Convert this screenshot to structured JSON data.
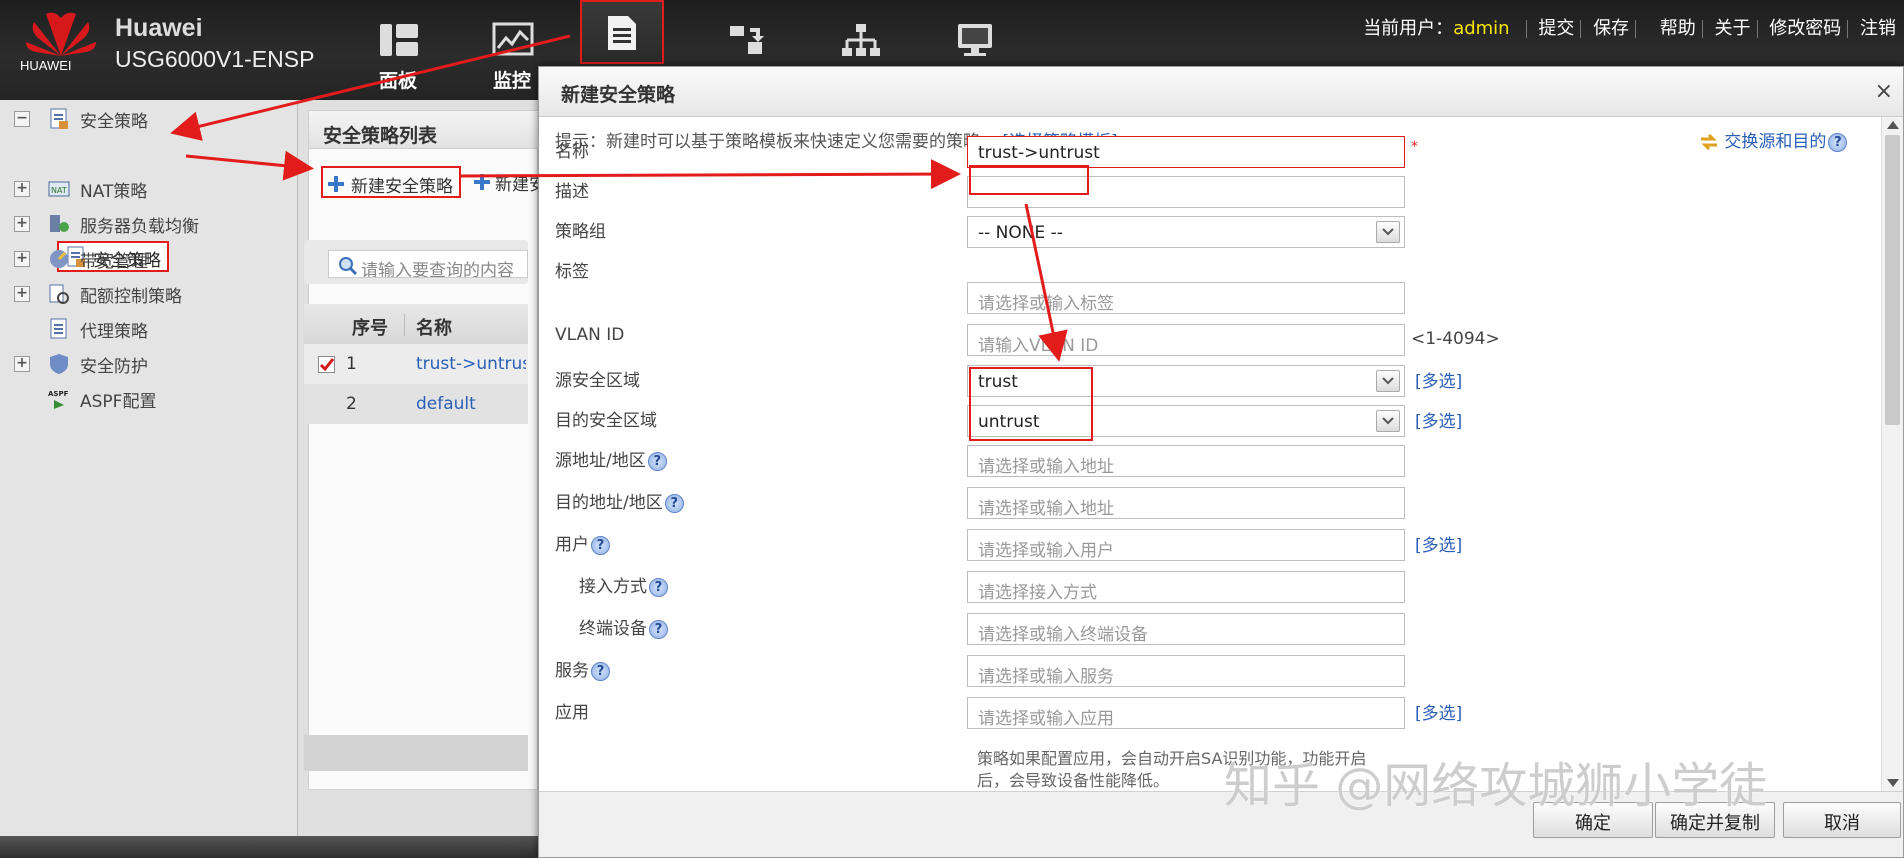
{
  "header": {
    "brand": "Huawei",
    "logo_text": "HUAWEI",
    "model": "USG6000V1-ENSP",
    "nav": [
      {
        "label": "面板",
        "icon": "dashboard-icon"
      },
      {
        "label": "监控",
        "icon": "monitor-chart-icon"
      },
      {
        "label": "",
        "icon": "policy-document-icon"
      },
      {
        "label": "",
        "icon": "object-icon"
      },
      {
        "label": "",
        "icon": "network-topology-icon"
      },
      {
        "label": "",
        "icon": "system-computer-icon"
      }
    ],
    "current_user_label": "当前用户：",
    "user": "admin",
    "links": [
      "提交",
      "保存",
      "帮助",
      "关于",
      "修改密码",
      "注销"
    ]
  },
  "sidebar": {
    "items": [
      {
        "label": "安全策略",
        "expander": "−",
        "icon": "security-policy-icon"
      },
      {
        "label": "安全策略",
        "icon": "security-policy-sub-icon"
      },
      {
        "label": "NAT策略",
        "expander": "+",
        "icon": "nat-icon"
      },
      {
        "label": "服务器负载均衡",
        "expander": "+",
        "icon": "server-lb-icon"
      },
      {
        "label": "带宽管理",
        "expander": "+",
        "icon": "bandwidth-icon"
      },
      {
        "label": "配额控制策略",
        "expander": "+",
        "icon": "quota-icon"
      },
      {
        "label": "代理策略",
        "icon": "proxy-icon"
      },
      {
        "label": "安全防护",
        "expander": "+",
        "icon": "shield-icon"
      },
      {
        "label": "ASPF配置",
        "icon": "aspf-icon"
      }
    ]
  },
  "list_panel": {
    "title": "安全策略列表",
    "new_button": "新建安全策略",
    "new_button2": "新建安",
    "search_placeholder": "请输入要查询的内容",
    "columns": [
      "序号",
      "名称"
    ],
    "rows": [
      {
        "no": "1",
        "name": "trust->untrust",
        "checked": true
      },
      {
        "no": "2",
        "name": "default",
        "checked": false
      }
    ]
  },
  "dialog": {
    "title": "新建安全策略",
    "close": "×",
    "hint": "提示：新建时可以基于策略模板来快速定义您需要的策略。",
    "hint_link": "[选择策略模板]",
    "swap": "交换源和目的",
    "fields": {
      "name": {
        "label": "名称",
        "value": "trust->untrust",
        "required": "*"
      },
      "desc": {
        "label": "描述",
        "value": ""
      },
      "group": {
        "label": "策略组",
        "value": "-- NONE --"
      },
      "tag": {
        "label": "标签",
        "placeholder": "请选择或输入标签"
      },
      "vlan": {
        "label": "VLAN ID",
        "placeholder": "请输入VLAN ID",
        "range": "<1-4094>"
      },
      "src_zone": {
        "label": "源安全区域",
        "value": "trust",
        "multi": "[多选]"
      },
      "dst_zone": {
        "label": "目的安全区域",
        "value": "untrust",
        "multi": "[多选]"
      },
      "src_addr": {
        "label": "源地址/地区",
        "placeholder": "请选择或输入地址"
      },
      "dst_addr": {
        "label": "目的地址/地区",
        "placeholder": "请选择或输入地址"
      },
      "user": {
        "label": "用户",
        "placeholder": "请选择或输入用户",
        "multi": "[多选]"
      },
      "access": {
        "label": "接入方式",
        "placeholder": "请选择接入方式"
      },
      "device": {
        "label": "终端设备",
        "placeholder": "请选择或输入终端设备"
      },
      "service": {
        "label": "服务",
        "placeholder": "请选择或输入服务"
      },
      "app": {
        "label": "应用",
        "placeholder": "请选择或输入应用",
        "multi": "[多选]"
      }
    },
    "app_note_1": "策略如果配置应用，会自动开启SA识别功能，功能开启",
    "app_note_2": "后，会导致设备性能降低。",
    "buttons": {
      "ok": "确定",
      "ok_copy": "确定并复制",
      "cancel": "取消"
    }
  },
  "watermark": "知乎 @网络攻城狮小学徒",
  "colors": {
    "accent_red": "#e21b1b",
    "link_blue": "#2a5fb8",
    "user_yellow": "#f7e600"
  }
}
